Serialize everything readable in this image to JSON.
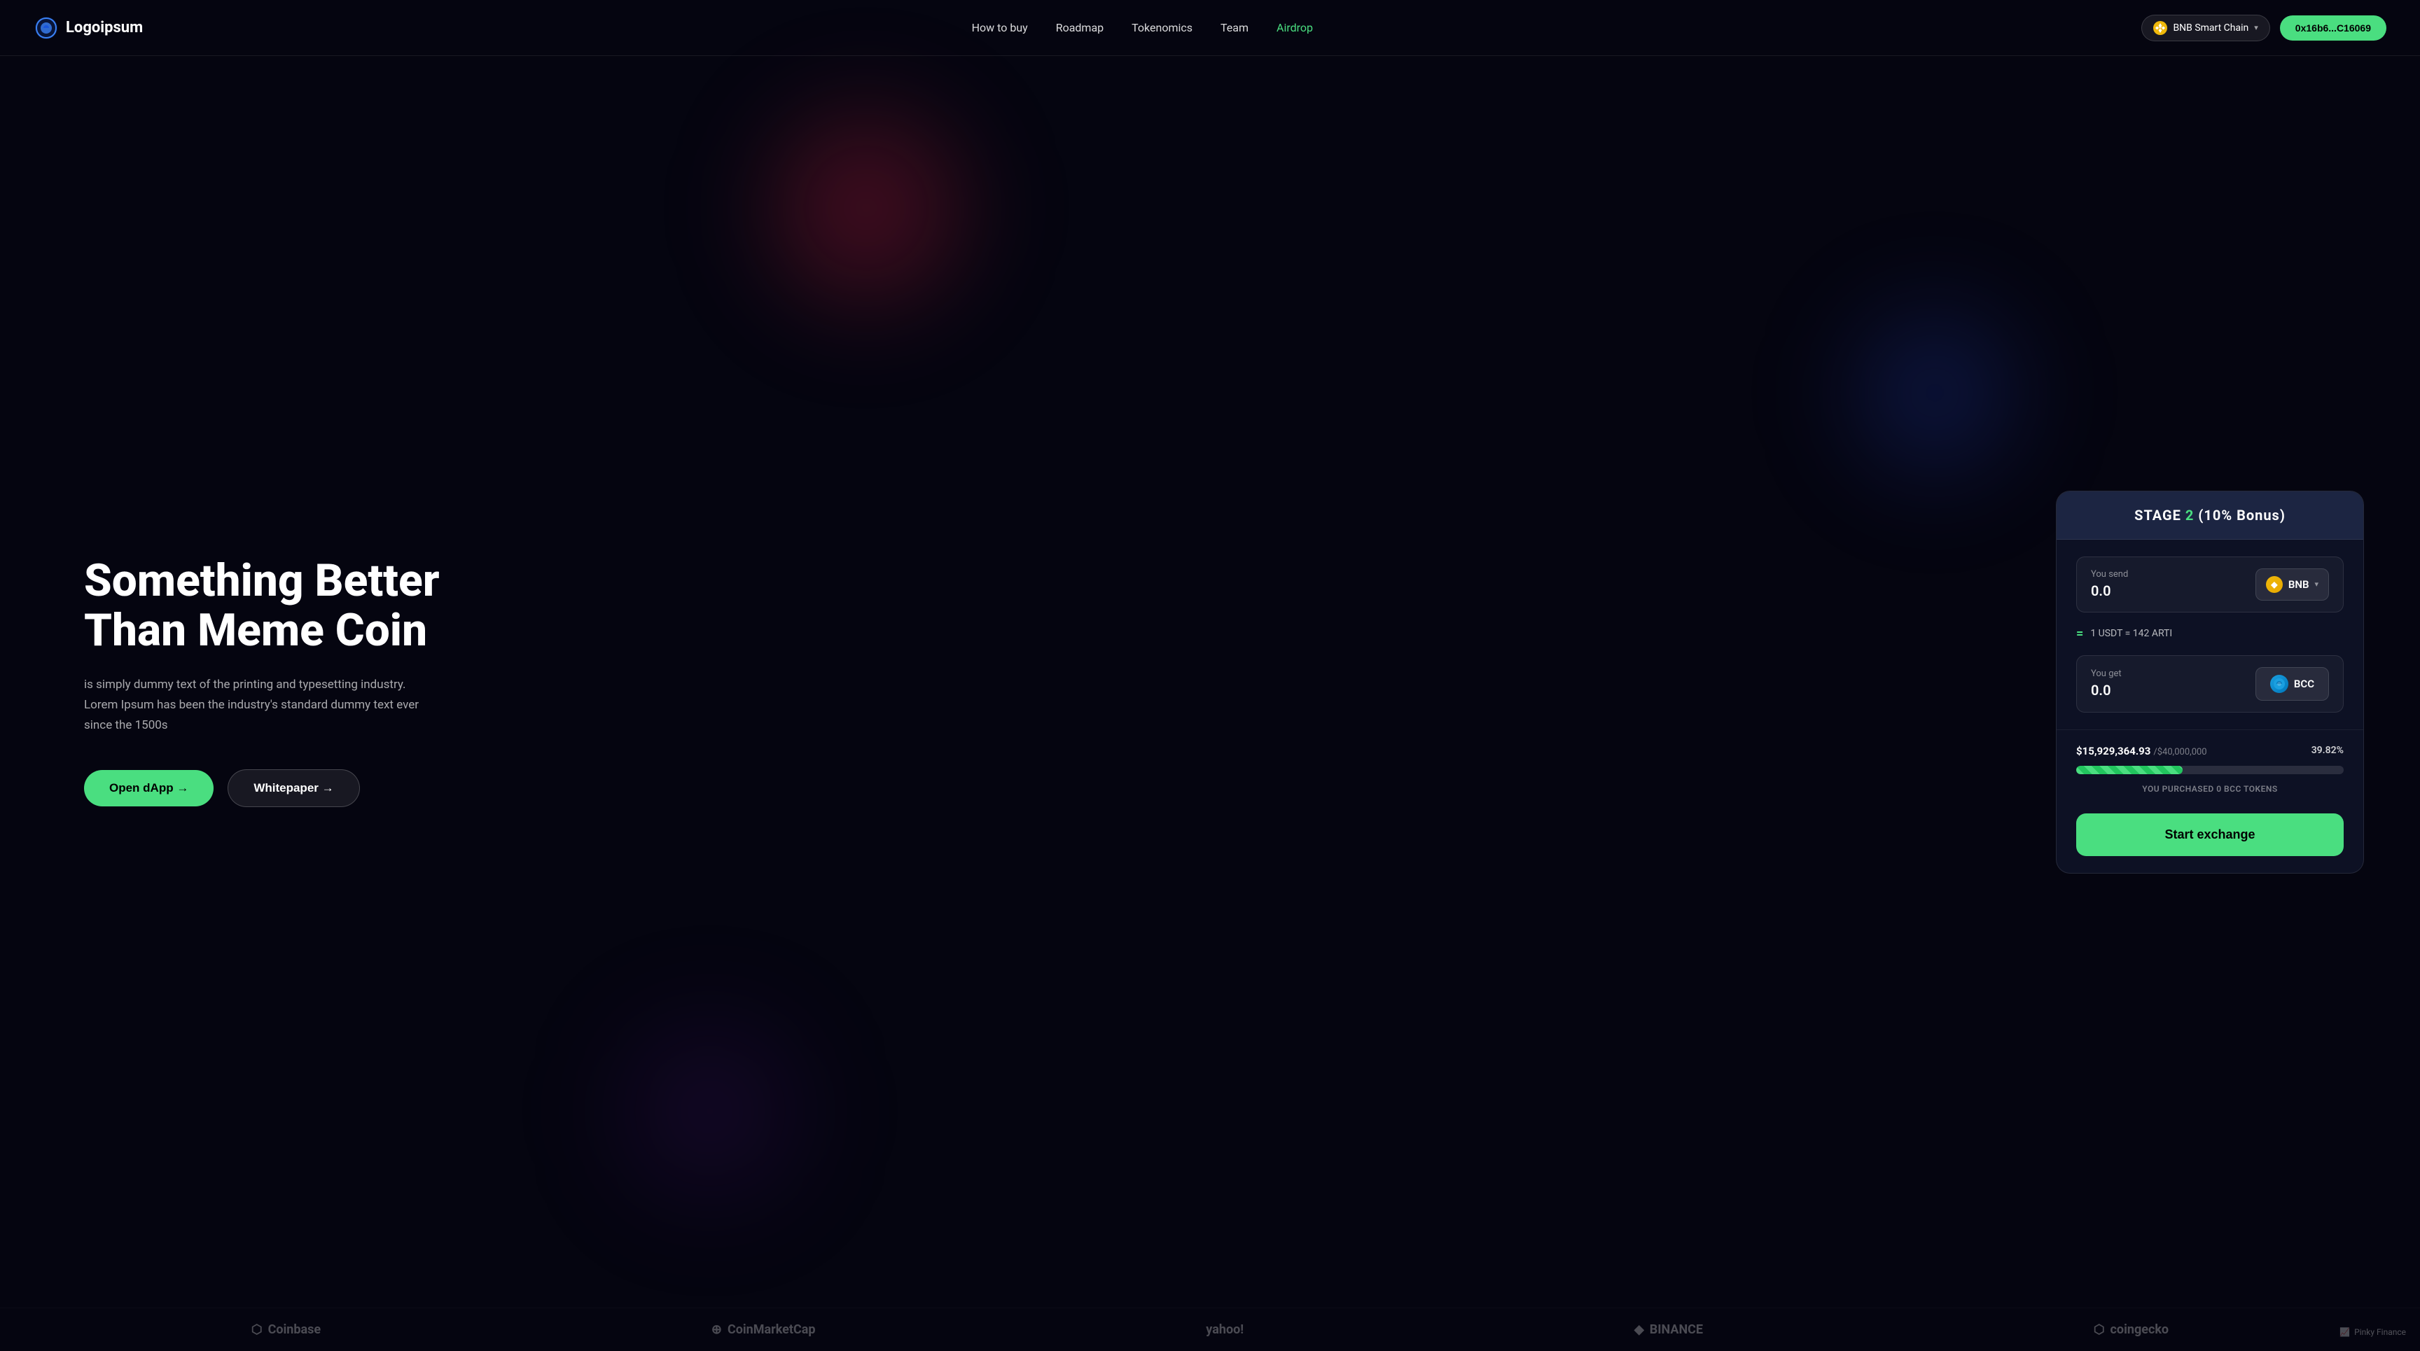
{
  "logo": {
    "text": "Logoipsum",
    "icon": "logo-icon"
  },
  "navbar": {
    "links": [
      {
        "id": "how-to-buy",
        "label": "How to buy",
        "active": false
      },
      {
        "id": "roadmap",
        "label": "Roadmap",
        "active": false
      },
      {
        "id": "tokenomics",
        "label": "Tokenomics",
        "active": false
      },
      {
        "id": "team",
        "label": "Team",
        "active": false
      },
      {
        "id": "airdrop",
        "label": "Airdrop",
        "active": true
      }
    ],
    "chain": {
      "name": "BNB Smart Chain",
      "icon": "bnb-chain-icon"
    },
    "wallet": {
      "label": "0x16b6...C16069"
    }
  },
  "hero": {
    "title": "Something Better Than Meme Coin",
    "subtitle": "is simply dummy text of the printing and typesetting industry. Lorem Ipsum has been the industry's standard dummy text ever since the 1500s",
    "btn_primary": "Open dApp →",
    "btn_secondary": "Whitepaper →"
  },
  "exchange": {
    "stage_label": "STAGE",
    "stage_number": "2",
    "stage_bonus": "(10% Bonus)",
    "send_label": "You send",
    "send_value": "0.0",
    "send_token": "BNB",
    "rate_text": "1 USDT = 142 ARTI",
    "equals": "=",
    "get_label": "You get",
    "get_value": "0.0",
    "get_token": "BCC",
    "raised_amount": "$15,929,364.93",
    "raised_total": "/$40,000,000",
    "progress_pct": "39.82%",
    "progress_fill": 39.82,
    "purchased_text": "YOU PURCHASED 0 BCC TOKENS",
    "exchange_btn": "Start exchange"
  },
  "footer_logos": [
    {
      "id": "coinbase",
      "label": "⬡ Coinbase"
    },
    {
      "id": "binance",
      "label": "◆ BINANCE"
    },
    {
      "id": "yahoo",
      "label": "yahoo!"
    },
    {
      "id": "coinmarketcap",
      "label": "⊕ CoinMarketCap"
    },
    {
      "id": "coingecko",
      "label": "⬡ coingecko"
    }
  ],
  "watermark": {
    "label": "Pinky Finance"
  },
  "colors": {
    "accent": "#4ade80",
    "bg": "#050510",
    "card_bg": "rgba(15,20,40,0.85)"
  }
}
